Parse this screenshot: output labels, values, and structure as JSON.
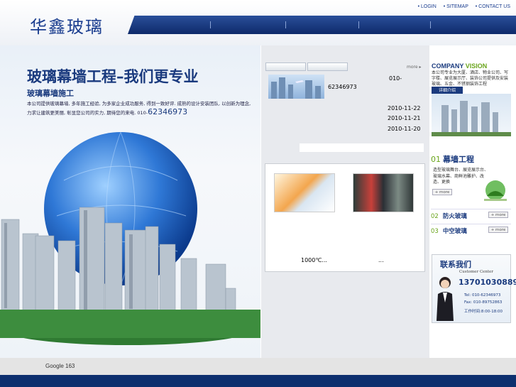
{
  "header": {
    "logo_text": "华鑫玻璃",
    "links": [
      "LOGIN",
      "SITEMAP",
      "CONTACT US"
    ]
  },
  "hero": {
    "title": "玻璃幕墙工程–我们更专业",
    "subtitle": "玻璃幕墙施工",
    "description": "本公司提供玻璃幕墙, 多年施工经验, 为多家企业成功服务, 得到一致好评. 成熟的设计安装团队, 以创新为理念, 力求让建筑更美丽, 彰显您公司的实力, 期待您的来电. 010-",
    "phone": "62346973"
  },
  "news": {
    "more_label": "more ▸",
    "phone_prefix": "010-",
    "phone": "62346973",
    "dates": [
      "2010-11-22",
      "2010-11-21",
      "2010-11-20"
    ]
  },
  "products": {
    "captions": [
      "1000℃...",
      "..."
    ]
  },
  "vision": {
    "title_a": "COMPANY",
    "title_b": "VISION",
    "text": "本公司专业为大厦、酒店、物业公司、写字楼、展览展示厅、装饰公司提供及安装玻璃、五金、不锈钢装饰工程",
    "detail_button": "详细介绍"
  },
  "services": {
    "first_num": "01",
    "first_title": "幕墙工程",
    "first_desc": "造型玻璃舞台、展览展示台、玻璃水幕、商鲜池雕护、改造、更换",
    "more_label": "+ more",
    "rows": [
      {
        "num": "02",
        "title": "防火玻璃"
      },
      {
        "num": "03",
        "title": "中空玻璃"
      }
    ]
  },
  "contact": {
    "title": "联系我们",
    "subtitle": "Customer Center",
    "phone": "13701030889",
    "tel": "Tel: 010-62346973",
    "fax": "Fax: 010-89752863",
    "hours": "工作时间:8:00-18:00"
  },
  "footer": {
    "links": "Google 163"
  },
  "colors": {
    "brand_blue": "#1a3a7e",
    "accent_green": "#6aa51c",
    "footer_blue": "#0d2f6e"
  }
}
